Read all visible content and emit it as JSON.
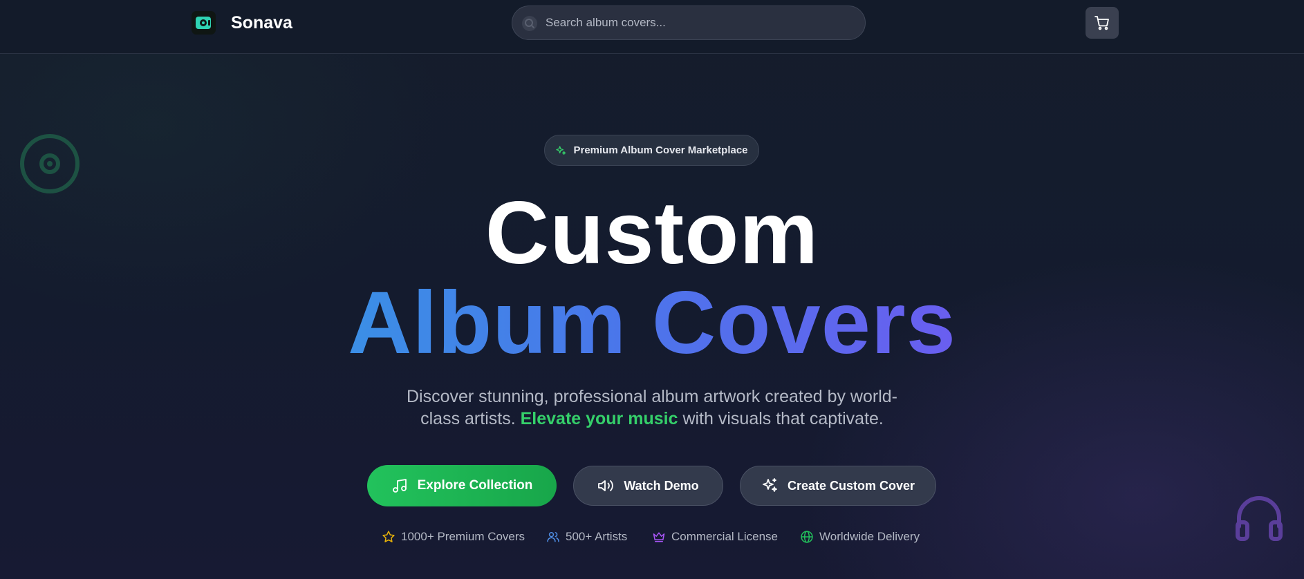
{
  "header": {
    "brand": "Sonava",
    "search_placeholder": "Search album covers...",
    "cart_label": "Cart"
  },
  "hero": {
    "badge": "Premium Album Cover Marketplace",
    "title_line1": "Custom",
    "title_line2": "Album Covers",
    "subtitle_part1": "Discover stunning, professional album artwork created by world-class artists.",
    "subtitle_highlight": "Elevate your music",
    "subtitle_part2": "with visuals that captivate."
  },
  "buttons": {
    "explore": "Explore Collection",
    "demo": "Watch Demo",
    "custom": "Create Custom Cover"
  },
  "stats": [
    {
      "label": "1000+ Premium Covers",
      "icon": "star-icon"
    },
    {
      "label": "500+ Artists",
      "icon": "users-icon"
    },
    {
      "label": "Commercial License",
      "icon": "crown-icon"
    },
    {
      "label": "Worldwide Delivery",
      "icon": "globe-icon"
    }
  ],
  "colors": {
    "accent_green": "#22c25c",
    "highlight_green": "#35cf6a",
    "gradient_start": "#3b8fe6",
    "gradient_end": "#6a5ef0",
    "background": "#141b2e"
  }
}
